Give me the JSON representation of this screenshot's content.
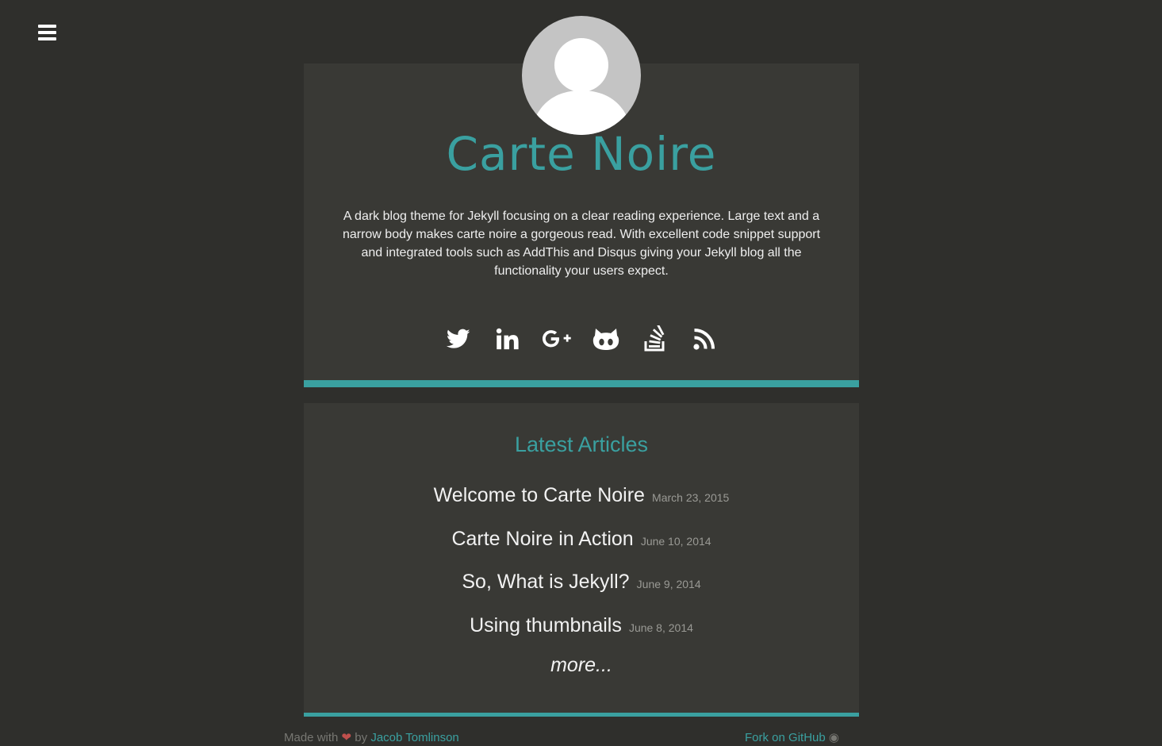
{
  "nav": {
    "menu_icon": "hamburger-menu-icon"
  },
  "profile": {
    "avatar_icon": "default-user-avatar",
    "site_title": "Carte Noire",
    "description": "A dark blog theme for Jekyll focusing on a clear reading experience. Large text and a narrow body makes carte noire a gorgeous read. With excellent code snippet support and integrated tools such as AddThis and Disqus giving your Jekyll blog all the functionality your users expect."
  },
  "social": [
    {
      "icon": "twitter-icon"
    },
    {
      "icon": "linkedin-icon"
    },
    {
      "icon": "google-plus-icon"
    },
    {
      "icon": "github-icon"
    },
    {
      "icon": "stackoverflow-icon"
    },
    {
      "icon": "rss-icon"
    }
  ],
  "articles": {
    "heading": "Latest Articles",
    "items": [
      {
        "title": "Welcome to Carte Noire",
        "date": "March 23, 2015"
      },
      {
        "title": "Carte Noire in Action",
        "date": "June 10, 2014"
      },
      {
        "title": "So, What is Jekyll?",
        "date": "June 9, 2014"
      },
      {
        "title": "Using thumbnails",
        "date": "June 8, 2014"
      }
    ],
    "more_label": "more..."
  },
  "footer": {
    "left_prefix": "Made with",
    "left_by": "by",
    "left_author": "Jacob Tomlinson",
    "right_text": "Jacob Tomlinson",
    "right_prefix": "Fork on GitHub"
  },
  "colors": {
    "background": "#2f2f2c",
    "card": "#393935",
    "accent": "#3aa0a0"
  }
}
